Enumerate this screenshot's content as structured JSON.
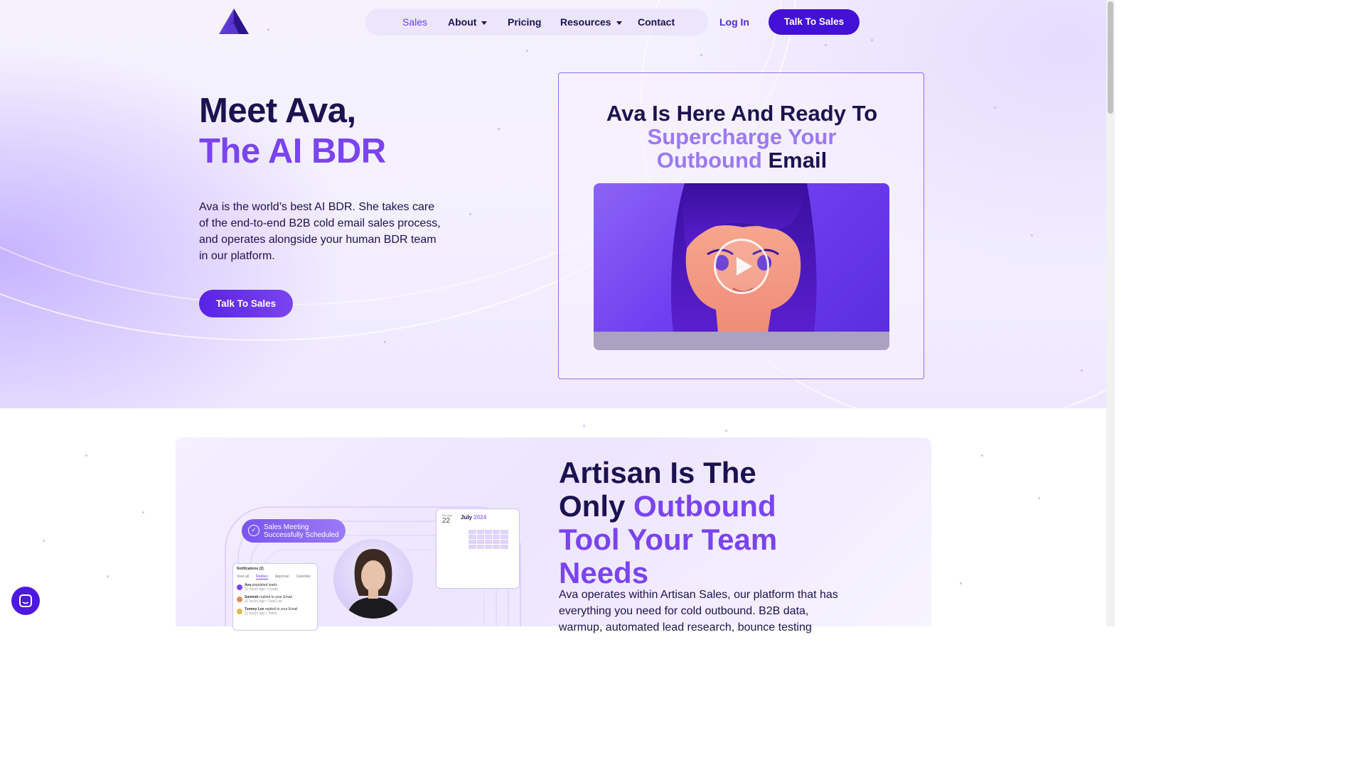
{
  "nav": {
    "items": [
      {
        "label": "Sales",
        "active": true,
        "dropdown": false
      },
      {
        "label": "About",
        "active": false,
        "dropdown": true
      },
      {
        "label": "Pricing",
        "active": false,
        "dropdown": false
      },
      {
        "label": "Resources",
        "active": false,
        "dropdown": true
      },
      {
        "label": "Contact",
        "active": false,
        "dropdown": false
      }
    ],
    "login_label": "Log In",
    "cta_label": "Talk To Sales"
  },
  "hero": {
    "title_line1": "Meet Ava,",
    "title_line2": "The AI BDR",
    "description": "Ava is the world’s best AI BDR. She takes care of the end-to-end B2B cold email sales process, and operates alongside your human BDR team in our platform.",
    "cta_label": "Talk To Sales"
  },
  "video_card": {
    "title_line1": "Ava Is Here And Ready To",
    "title_line2": "Supercharge Your",
    "title_line3_accent": "Outbound",
    "title_line3_rest": " Email"
  },
  "section2": {
    "title_part1": "Artisan Is The Only ",
    "title_accent": "Outbound",
    "title_part2": " Tool Your Team Needs",
    "description": "Ava operates within Artisan Sales, our platform that has everything you need for cold outbound. B2B data, warmup, automated lead research, bounce testing"
  },
  "illustration": {
    "badge": "Sales Meeting Successfully Scheduled",
    "notifications_title": "Notifications (2)",
    "notifications_tabs": [
      "View all",
      "Replies",
      "Approval",
      "Calendar"
    ],
    "notifications": [
      {
        "name": "Ava",
        "text": "populated leads",
        "meta": "11 hours ago • Leads"
      },
      {
        "name": "Samirah",
        "text": "replied to your Email",
        "meta": "11 hours ago • Task List"
      },
      {
        "name": "Tommy Lee",
        "text": "replied to your Email",
        "meta": "11 hours ago • Inbox"
      }
    ],
    "calendar_month": "July",
    "calendar_year": "2024",
    "calendar_weekday": "Monday",
    "calendar_day": "22"
  },
  "colors": {
    "brand": "#4310d8",
    "accent": "#7a44f0",
    "text": "#1c1250"
  }
}
